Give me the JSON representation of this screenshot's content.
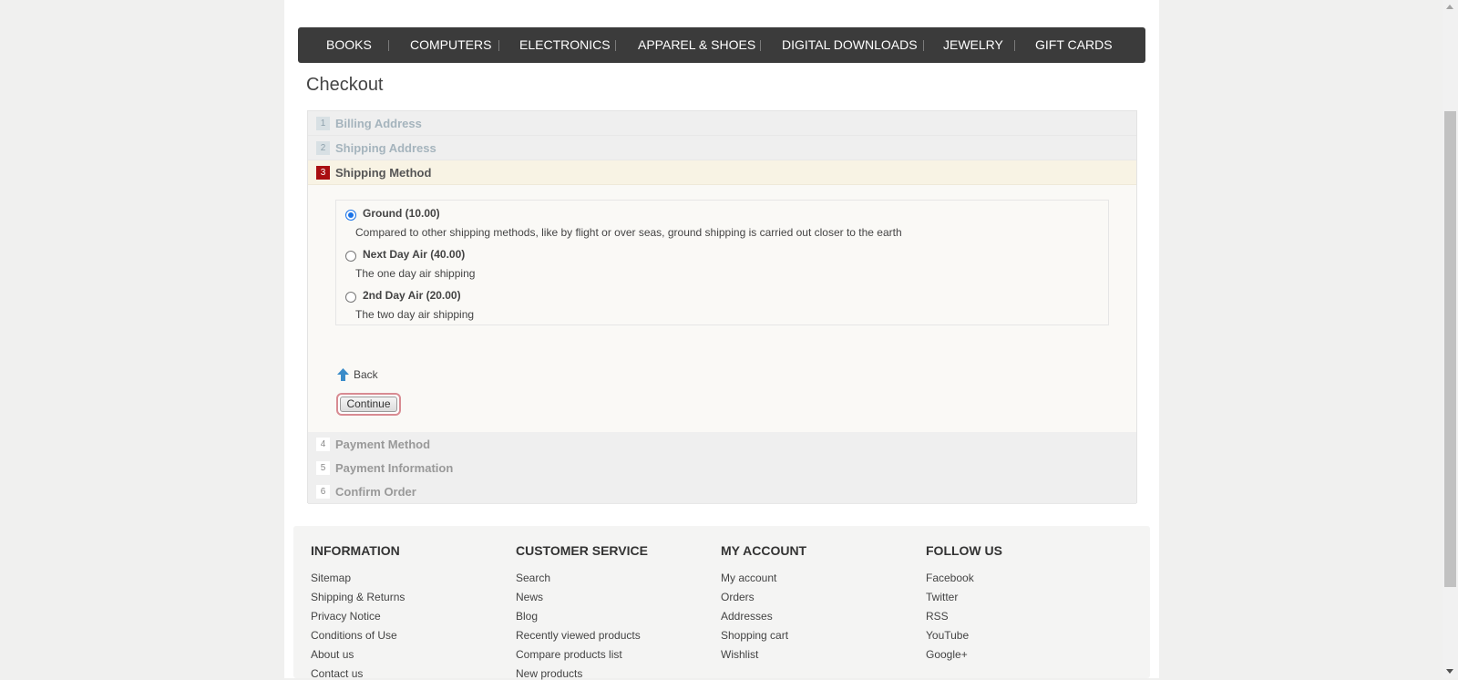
{
  "nav": {
    "items": [
      "BOOKS",
      "COMPUTERS",
      "ELECTRONICS",
      "APPAREL & SHOES",
      "DIGITAL DOWNLOADS",
      "JEWELRY",
      "GIFT CARDS"
    ]
  },
  "page_title": "Checkout",
  "steps": [
    {
      "num": "1",
      "label": "Billing Address",
      "state": "done"
    },
    {
      "num": "2",
      "label": "Shipping Address",
      "state": "done"
    },
    {
      "num": "3",
      "label": "Shipping Method",
      "state": "active"
    },
    {
      "num": "4",
      "label": "Payment Method",
      "state": "future"
    },
    {
      "num": "5",
      "label": "Payment Information",
      "state": "future"
    },
    {
      "num": "6",
      "label": "Confirm Order",
      "state": "future"
    }
  ],
  "shipping_methods": [
    {
      "name": "Ground (10.00)",
      "description": "Compared to other shipping methods, like by flight or over seas, ground shipping is carried out closer to the earth",
      "selected": true
    },
    {
      "name": "Next Day Air (40.00)",
      "description": "The one day air shipping",
      "selected": false
    },
    {
      "name": "2nd Day Air (20.00)",
      "description": "The two day air shipping",
      "selected": false
    }
  ],
  "back_label": "Back",
  "continue_label": "Continue",
  "footer": {
    "columns": [
      {
        "title": "INFORMATION",
        "links": [
          "Sitemap",
          "Shipping & Returns",
          "Privacy Notice",
          "Conditions of Use",
          "About us",
          "Contact us"
        ]
      },
      {
        "title": "CUSTOMER SERVICE",
        "links": [
          "Search",
          "News",
          "Blog",
          "Recently viewed products",
          "Compare products list",
          "New products"
        ]
      },
      {
        "title": "MY ACCOUNT",
        "links": [
          "My account",
          "Orders",
          "Addresses",
          "Shopping cart",
          "Wishlist"
        ]
      },
      {
        "title": "FOLLOW US",
        "links": [
          "Facebook",
          "Twitter",
          "RSS",
          "YouTube",
          "Google+"
        ]
      }
    ]
  },
  "colors": {
    "nav_bg": "#3b3b3b",
    "active_step_badge": "#a90e10",
    "continue_focus_ring": "#d88b92",
    "radio_selected": "#1a73e8"
  }
}
